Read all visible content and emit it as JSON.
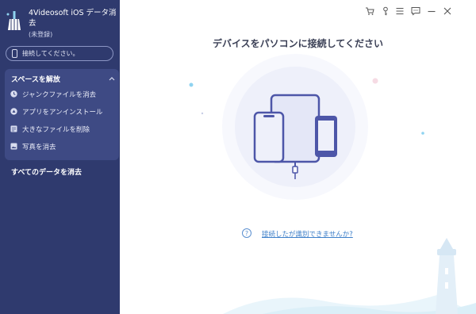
{
  "app": {
    "title": "4Videosoft iOS データ消去",
    "status": "(未登録)",
    "device_status": "接続してください。"
  },
  "sidebar": {
    "section_title": "スペースを解放",
    "items": [
      {
        "label": "ジャンクファイルを消去",
        "icon": "clock-icon"
      },
      {
        "label": "アプリをアンインストール",
        "icon": "app-icon"
      },
      {
        "label": "大きなファイルを削除",
        "icon": "file-icon"
      },
      {
        "label": "写真を消去",
        "icon": "photo-icon"
      }
    ],
    "erase_all": "すべてのデータを消去"
  },
  "topbar": {
    "icons": [
      "cart-icon",
      "key-icon",
      "menu-icon",
      "feedback-icon",
      "minimize-icon",
      "close-icon"
    ]
  },
  "main": {
    "title": "デバイスをパソコンに接続してください",
    "help_link": "接続したが識別できませんか?"
  },
  "colors": {
    "sidebar_bg": "#2f3a6e",
    "sidebar_section_bg": "#3e4a84",
    "link": "#3d7fc9",
    "device_purple": "#4d56a8"
  }
}
